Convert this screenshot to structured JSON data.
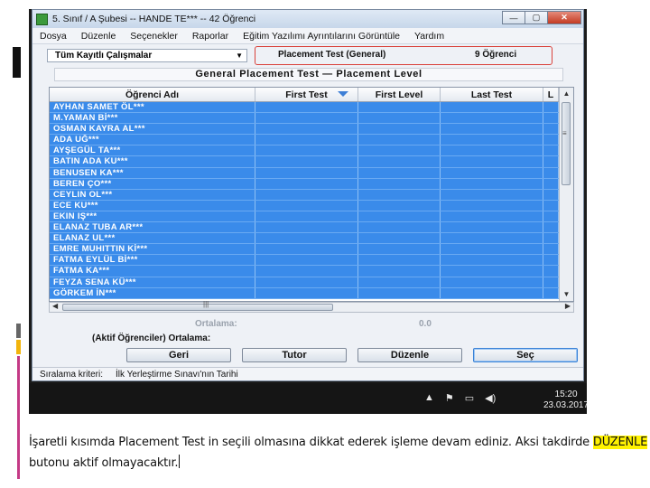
{
  "window": {
    "title": "5. Sınıf / A Şubesi -- HANDE TE*** -- 42 Öğrenci",
    "minimize_label": "—",
    "maximize_label": "▢",
    "close_label": "✕"
  },
  "menu": [
    "Dosya",
    "Düzenle",
    "Seçenekler",
    "Raporlar",
    "Eğitim Yazılımı Ayrıntılarını Görüntüle",
    "Yardım"
  ],
  "filter": {
    "selected": "Tüm Kayıtlı Çalışmalar",
    "test_name": "Placement Test (General)",
    "student_count": "9 Öğrenci"
  },
  "group_title": "General Placement Test  —  Placement Level",
  "table": {
    "columns": [
      "Öğrenci Adı",
      "First Test",
      "First Level",
      "Last Test",
      "L"
    ],
    "sorted_column": 1,
    "rows": [
      "AYHAN SAMET ÖL***",
      "M.YAMAN Bİ***",
      "OSMAN KAYRA AL***",
      "ADA UĞ***",
      "AYŞEGÜL TA***",
      "BATIN ADA KU***",
      "BENUSEN KA***",
      "BEREN ÇO***",
      "CEYLIN OL***",
      "ECE KU***",
      "EKIN IŞ***",
      "ELANAZ TUBA AR***",
      "ELANAZ UL***",
      "EMRE MUHITTIN Kİ***",
      "FATMA EYLÜL Bİ***",
      "FATMA KA***",
      "FEYZA SENA KÜ***",
      "GÖRKEM İN***"
    ]
  },
  "summary": {
    "average_label": "Ortalama:",
    "average_value": "0.0",
    "active_label": "(Aktif Öğrenciler) Ortalama:"
  },
  "buttons": {
    "back": "Geri",
    "tutor": "Tutor",
    "edit": "Düzenle",
    "select": "Seç"
  },
  "status": {
    "label": "Sıralama kriteri:",
    "value": "İlk Yerleştirme Sınavı'nın Tarihi"
  },
  "taskbar": {
    "time": "15:20",
    "date": "23.03.2017"
  },
  "caption": {
    "part1": "İşaretli kısımda Placement Test in seçili olmasına dikkat ederek işleme devam ediniz. Aksi takdirde ",
    "highlight": "DÜZENLE",
    "part2": "butonu aktif olmayacaktır."
  },
  "colors": {
    "selection_row": "#3a8bea",
    "highlight_box": "#d9423b",
    "caption_highlight": "#fff200",
    "accent_bar": "#c43a86",
    "accent_dot": "#f2b40c"
  }
}
